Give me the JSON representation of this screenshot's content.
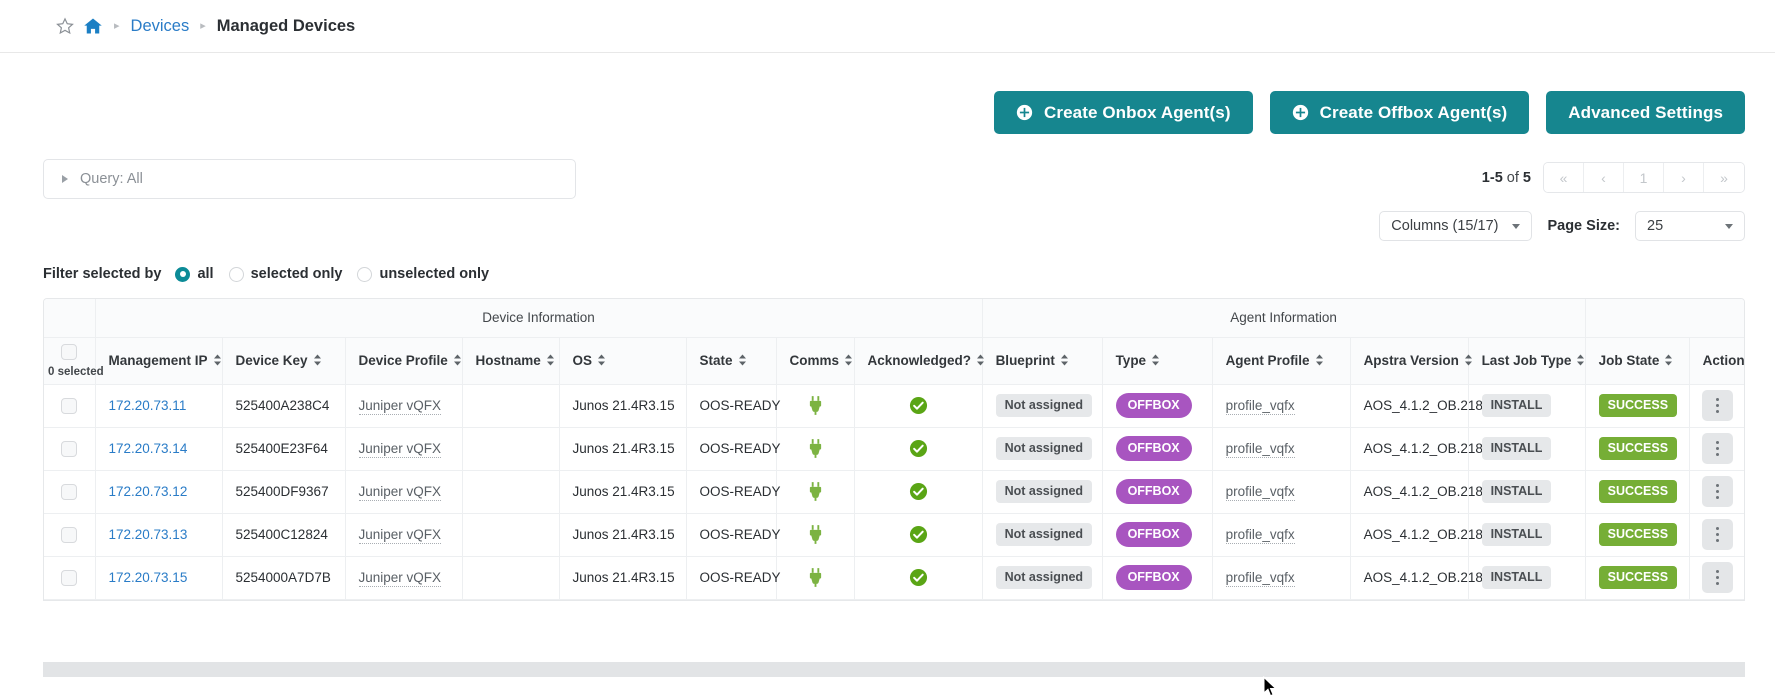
{
  "breadcrumb": {
    "star_icon": "star-icon",
    "home_icon": "home-icon",
    "sep": "▸",
    "link": "Devices",
    "current": "Managed Devices"
  },
  "toolbar": {
    "create_onbox": "Create Onbox Agent(s)",
    "create_offbox": "Create Offbox Agent(s)",
    "advanced_settings": "Advanced Settings",
    "accent_color": "#16868f"
  },
  "query": {
    "text": "Query: All"
  },
  "pagination": {
    "range": "1-5",
    "of_text": "of",
    "total": "5",
    "first": "«",
    "prev": "‹",
    "page": "1",
    "next": "›",
    "last": "»"
  },
  "table_controls": {
    "columns_label": "Columns (15/17)",
    "page_size_label": "Page Size:",
    "page_size_value": "25"
  },
  "filter": {
    "label": "Filter selected by",
    "options": [
      {
        "label": "all",
        "checked": true
      },
      {
        "label": "selected only",
        "checked": false
      },
      {
        "label": "unselected only",
        "checked": false
      }
    ]
  },
  "table": {
    "selection_count": "0 selected",
    "group_headers": [
      {
        "label": "",
        "span": 1
      },
      {
        "label": "Device Information",
        "span": 8
      },
      {
        "label": "Agent Information",
        "span": 5
      },
      {
        "label": "",
        "span": 1
      }
    ],
    "columns": [
      "Management IP",
      "Device Key",
      "Device Profile",
      "Hostname",
      "OS",
      "State",
      "Comms",
      "Acknowledged?",
      "Blueprint",
      "Type",
      "Agent Profile",
      "Apstra Version",
      "Last Job Type",
      "Job State",
      "Actions"
    ],
    "rows": [
      {
        "management_ip": "172.20.73.11",
        "device_key": "525400A238C4",
        "device_profile": "Juniper vQFX",
        "hostname": "",
        "os": "Junos 21.4R3.15",
        "state": "OOS-READY",
        "comms": "plug-icon",
        "acknowledged": "check-circle-icon",
        "blueprint": "Not assigned",
        "type": "OFFBOX",
        "agent_profile": "profile_vqfx",
        "apstra_version": "AOS_4.1.2_OB.218",
        "last_job_type": "INSTALL",
        "job_state": "SUCCESS"
      },
      {
        "management_ip": "172.20.73.14",
        "device_key": "525400E23F64",
        "device_profile": "Juniper vQFX",
        "hostname": "",
        "os": "Junos 21.4R3.15",
        "state": "OOS-READY",
        "comms": "plug-icon",
        "acknowledged": "check-circle-icon",
        "blueprint": "Not assigned",
        "type": "OFFBOX",
        "agent_profile": "profile_vqfx",
        "apstra_version": "AOS_4.1.2_OB.218",
        "last_job_type": "INSTALL",
        "job_state": "SUCCESS"
      },
      {
        "management_ip": "172.20.73.12",
        "device_key": "525400DF9367",
        "device_profile": "Juniper vQFX",
        "hostname": "",
        "os": "Junos 21.4R3.15",
        "state": "OOS-READY",
        "comms": "plug-icon",
        "acknowledged": "check-circle-icon",
        "blueprint": "Not assigned",
        "type": "OFFBOX",
        "agent_profile": "profile_vqfx",
        "apstra_version": "AOS_4.1.2_OB.218",
        "last_job_type": "INSTALL",
        "job_state": "SUCCESS"
      },
      {
        "management_ip": "172.20.73.13",
        "device_key": "525400C12824",
        "device_profile": "Juniper vQFX",
        "hostname": "",
        "os": "Junos 21.4R3.15",
        "state": "OOS-READY",
        "comms": "plug-icon",
        "acknowledged": "check-circle-icon",
        "blueprint": "Not assigned",
        "type": "OFFBOX",
        "agent_profile": "profile_vqfx",
        "apstra_version": "AOS_4.1.2_OB.218",
        "last_job_type": "INSTALL",
        "job_state": "SUCCESS"
      },
      {
        "management_ip": "172.20.73.15",
        "device_key": "5254000A7D7B",
        "device_profile": "Juniper vQFX",
        "hostname": "",
        "os": "Junos 21.4R3.15",
        "state": "OOS-READY",
        "comms": "plug-icon",
        "acknowledged": "check-circle-icon",
        "blueprint": "Not assigned",
        "type": "OFFBOX",
        "agent_profile": "profile_vqfx",
        "apstra_version": "AOS_4.1.2_OB.218",
        "last_job_type": "INSTALL",
        "job_state": "SUCCESS"
      }
    ]
  },
  "colors": {
    "link": "#2a7cc7",
    "teal": "#16868f",
    "purple": "#a855c0",
    "green": "#76ae36",
    "grey_badge": "#e6e8ea"
  }
}
